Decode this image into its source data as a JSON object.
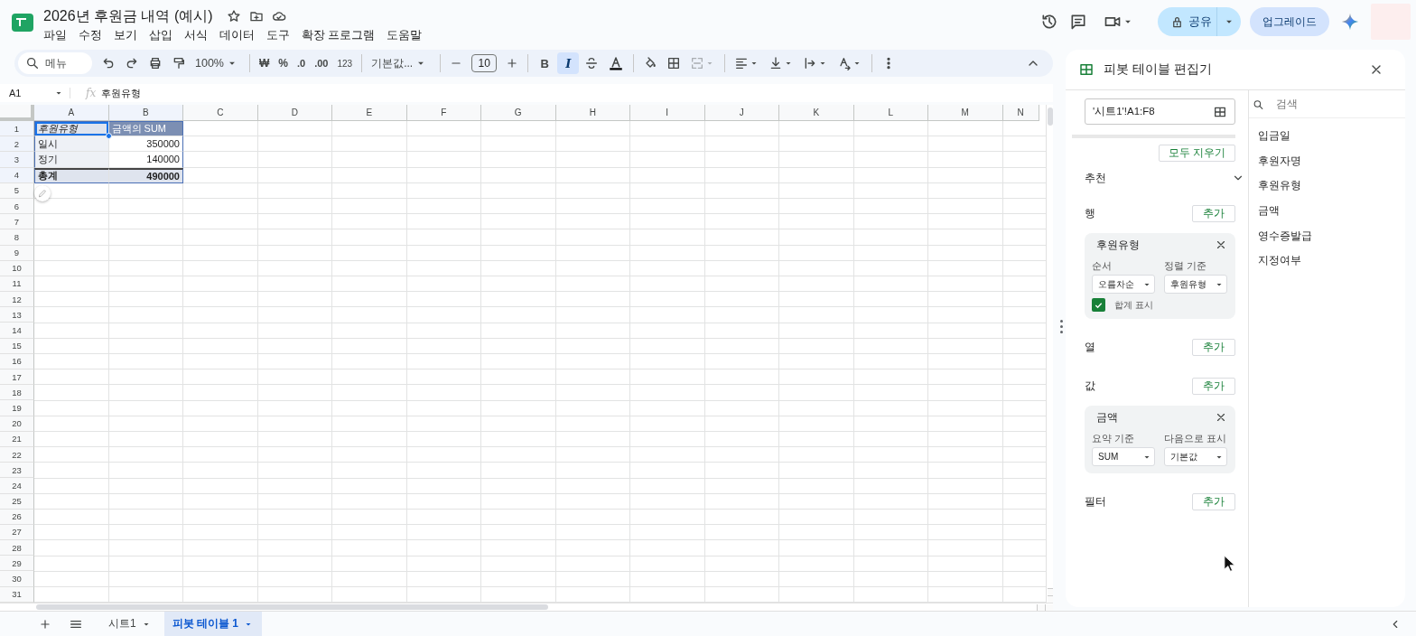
{
  "header": {
    "title": "2026년 후원금 내역 (예시)",
    "menus": [
      "파일",
      "수정",
      "보기",
      "삽입",
      "서식",
      "데이터",
      "도구",
      "확장 프로그램",
      "도움말"
    ],
    "share": "공유",
    "upgrade": "업그레이드"
  },
  "toolbar": {
    "search_placeholder": "메뉴",
    "zoom": "100%",
    "currency": "₩",
    "percent": "%",
    "decrease_decimal": ".0",
    "increase_decimal": ".00",
    "number_format": "123",
    "font": "기본값...",
    "font_size": "10",
    "bold": {
      "label": "B",
      "on": false
    },
    "italic": {
      "label": "I",
      "on": true
    }
  },
  "formula_bar": {
    "cell_ref": "A1",
    "fx": "fx",
    "content": "후원유형"
  },
  "sheet": {
    "columns": [
      "A",
      "B",
      "C",
      "D",
      "E",
      "F",
      "G",
      "H",
      "I",
      "J",
      "K",
      "L",
      "M",
      "N"
    ],
    "rows": [
      "1",
      "2",
      "3",
      "4",
      "5",
      "6",
      "7",
      "8",
      "9",
      "10",
      "11",
      "12",
      "13",
      "14",
      "15",
      "16",
      "17",
      "18",
      "19",
      "20",
      "21",
      "22",
      "23",
      "24",
      "25",
      "26",
      "27",
      "28",
      "29",
      "30",
      "31"
    ],
    "cells": [
      [
        {
          "text": "후원유형",
          "kind": "row-header",
          "selected": true
        },
        {
          "text": "금액의 SUM",
          "kind": "value-header",
          "selected": false
        }
      ],
      [
        {
          "text": "일시",
          "kind": "row-label",
          "selected": false
        },
        {
          "text": "350000",
          "kind": "value",
          "selected": false
        }
      ],
      [
        {
          "text": "정기",
          "kind": "row-label",
          "selected": false
        },
        {
          "text": "140000",
          "kind": "value",
          "selected": false
        }
      ],
      [
        {
          "text": "총계",
          "kind": "total-label",
          "selected": false
        },
        {
          "text": "490000",
          "kind": "total-value",
          "selected": false
        }
      ]
    ]
  },
  "sheet_tabs": [
    {
      "label": "시트1",
      "selected": false
    },
    {
      "label": "피봇 테이블 1",
      "selected": true
    }
  ],
  "pivot_editor": {
    "title": "피봇 테이블 편집기",
    "range": "'시트1'!A1:F8",
    "clear_all": "모두 지우기",
    "suggested": {
      "label": "추천",
      "expanded": false
    },
    "sections": [
      {
        "label": "행",
        "add": "추가",
        "cards": [
          {
            "title": "후원유형",
            "fields": [
              {
                "label": "순서",
                "value": "오름차순"
              },
              {
                "label": "정렬 기준",
                "value": "후원유형"
              }
            ],
            "checkbox": {
              "label": "합계 표시",
              "checked": true
            }
          }
        ]
      },
      {
        "label": "열",
        "add": "추가"
      },
      {
        "label": "값",
        "add": "추가",
        "cards": [
          {
            "title": "금액",
            "fields": [
              {
                "label": "요약 기준",
                "value": "SUM"
              },
              {
                "label": "다음으로 표시",
                "value": "기본값"
              }
            ]
          }
        ]
      },
      {
        "label": "필터",
        "add": "추가"
      }
    ],
    "search_placeholder": "검색",
    "fields": [
      "입금일",
      "후원자명",
      "후원유형",
      "금액",
      "영수증발급",
      "지정여부"
    ]
  }
}
